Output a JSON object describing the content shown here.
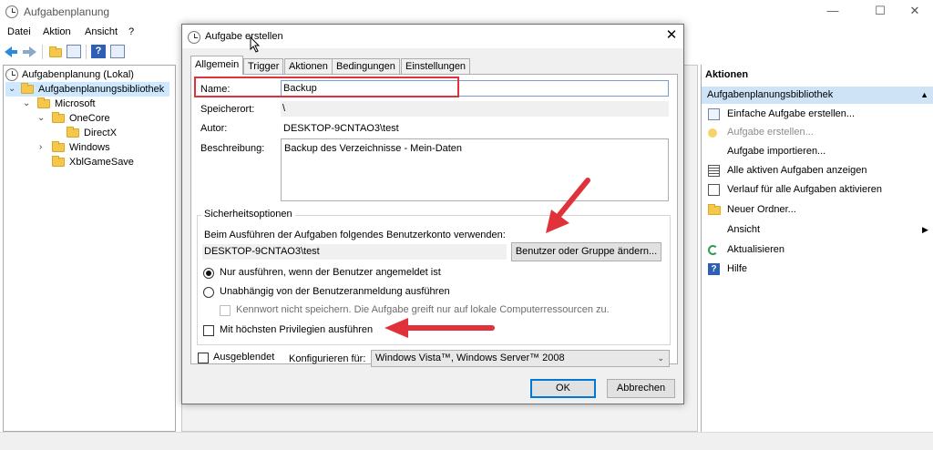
{
  "window": {
    "title": "Aufgabenplanung",
    "minimize": "—",
    "maximize": "☐",
    "close": "✕"
  },
  "menu": {
    "items": [
      "Datei",
      "Aktion",
      "Ansicht",
      "?"
    ]
  },
  "tree": {
    "root": "Aufgabenplanung (Lokal)",
    "library": "Aufgabenplanungsbibliothek",
    "microsoft": "Microsoft",
    "onecore": "OneCore",
    "directx": "DirectX",
    "windows": "Windows",
    "xblgamesave": "XblGameSave"
  },
  "actions": {
    "header": "Aktionen",
    "section": "Aufgabenplanungsbibliothek",
    "items": [
      {
        "label": "Einfache Aufgabe erstellen...",
        "icon": "wand-icon"
      },
      {
        "label": "Aufgabe erstellen...",
        "icon": "task-icon",
        "disabled": true
      },
      {
        "label": "Aufgabe importieren...",
        "icon": "none"
      },
      {
        "label": "Alle aktiven Aufgaben anzeigen",
        "icon": "list-icon"
      },
      {
        "label": "Verlauf für alle Aufgaben aktivieren",
        "icon": "history-icon"
      },
      {
        "label": "Neuer Ordner...",
        "icon": "folder-icon"
      },
      {
        "label": "Ansicht",
        "icon": "none"
      },
      {
        "label": "Aktualisieren",
        "icon": "refresh-icon"
      },
      {
        "label": "Hilfe",
        "icon": "help-icon"
      }
    ]
  },
  "dialog": {
    "title": "Aufgabe erstellen",
    "close": "✕",
    "tabs": [
      "Allgemein",
      "Trigger",
      "Aktionen",
      "Bedingungen",
      "Einstellungen"
    ],
    "name_label": "Name:",
    "name_value": "Backup",
    "location_label": "Speicherort:",
    "location_value": "\\",
    "author_label": "Autor:",
    "author_value": "DESKTOP-9CNTAO3\\test",
    "description_label": "Beschreibung:",
    "description_value": "Backup des Verzeichnisse - Mein-Daten",
    "security": {
      "title": "Sicherheitsoptionen",
      "account_prompt": "Beim Ausführen der Aufgaben folgendes Benutzerkonto verwenden:",
      "account_value": "DESKTOP-9CNTAO3\\test",
      "change_button": "Benutzer oder Gruppe ändern...",
      "radio_logged_on": "Nur ausführen, wenn der Benutzer angemeldet ist",
      "radio_independent": "Unabhängig von der Benutzeranmeldung ausführen",
      "no_password": "Kennwort nicht speichern. Die Aufgabe greift nur auf lokale Computerressourcen zu.",
      "highest_privileges": "Mit höchsten Privilegien ausführen"
    },
    "hidden_label": "Ausgeblendet",
    "configure_label": "Konfigurieren für:",
    "configure_value": "Windows Vista™, Windows Server™ 2008",
    "ok": "OK",
    "cancel": "Abbrechen"
  },
  "colors": {
    "highlight": "#e0323b",
    "selection": "#cde8ff",
    "actions_section": "#cfe3f6"
  }
}
